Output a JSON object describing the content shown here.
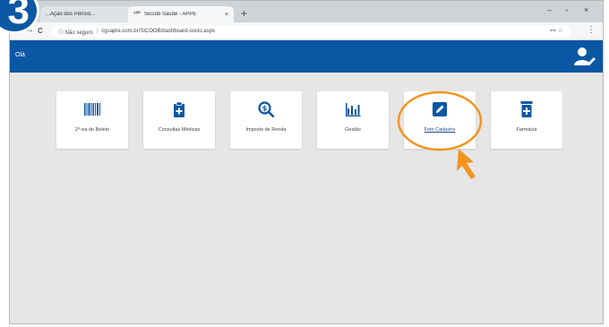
{
  "step_badge": "3",
  "browser": {
    "tabs": [
      {
        "label": "...Ação dos Pensio...",
        "favicon": ""
      },
      {
        "label": "Sicoob Saúde - APPE",
        "favicon": "ᴬᴾᴾ"
      }
    ],
    "tab_close": "×",
    "new_tab": "+",
    "window_controls": [
      "–",
      "▫",
      "×"
    ],
    "nav": {
      "back": "←",
      "forward": "→",
      "reload": "C"
    },
    "address": {
      "security": "ⓘ Não seguro",
      "url": "cgsapre.com.br/SICOOB/dashboard-socio.aspx"
    },
    "address_icons": "⊶ ☆",
    "menu": "⋮"
  },
  "app": {
    "header_crumb": "Olá",
    "brand_color": "#0b57a3"
  },
  "cards": [
    {
      "label": "2ª via do Boleto",
      "icon": "barcode-icon"
    },
    {
      "label": "Consultas Médicas",
      "icon": "clipboard-plus-icon"
    },
    {
      "label": "Imposto de Renda",
      "icon": "magnify-coin-icon"
    },
    {
      "label": "Gestão",
      "icon": "bar-chart-icon"
    },
    {
      "label": "Foto Cadastro",
      "icon": "edit-icon"
    },
    {
      "label": "Farmácia",
      "icon": "pill-bottle-icon"
    }
  ],
  "highlight_color": "#f2941f"
}
